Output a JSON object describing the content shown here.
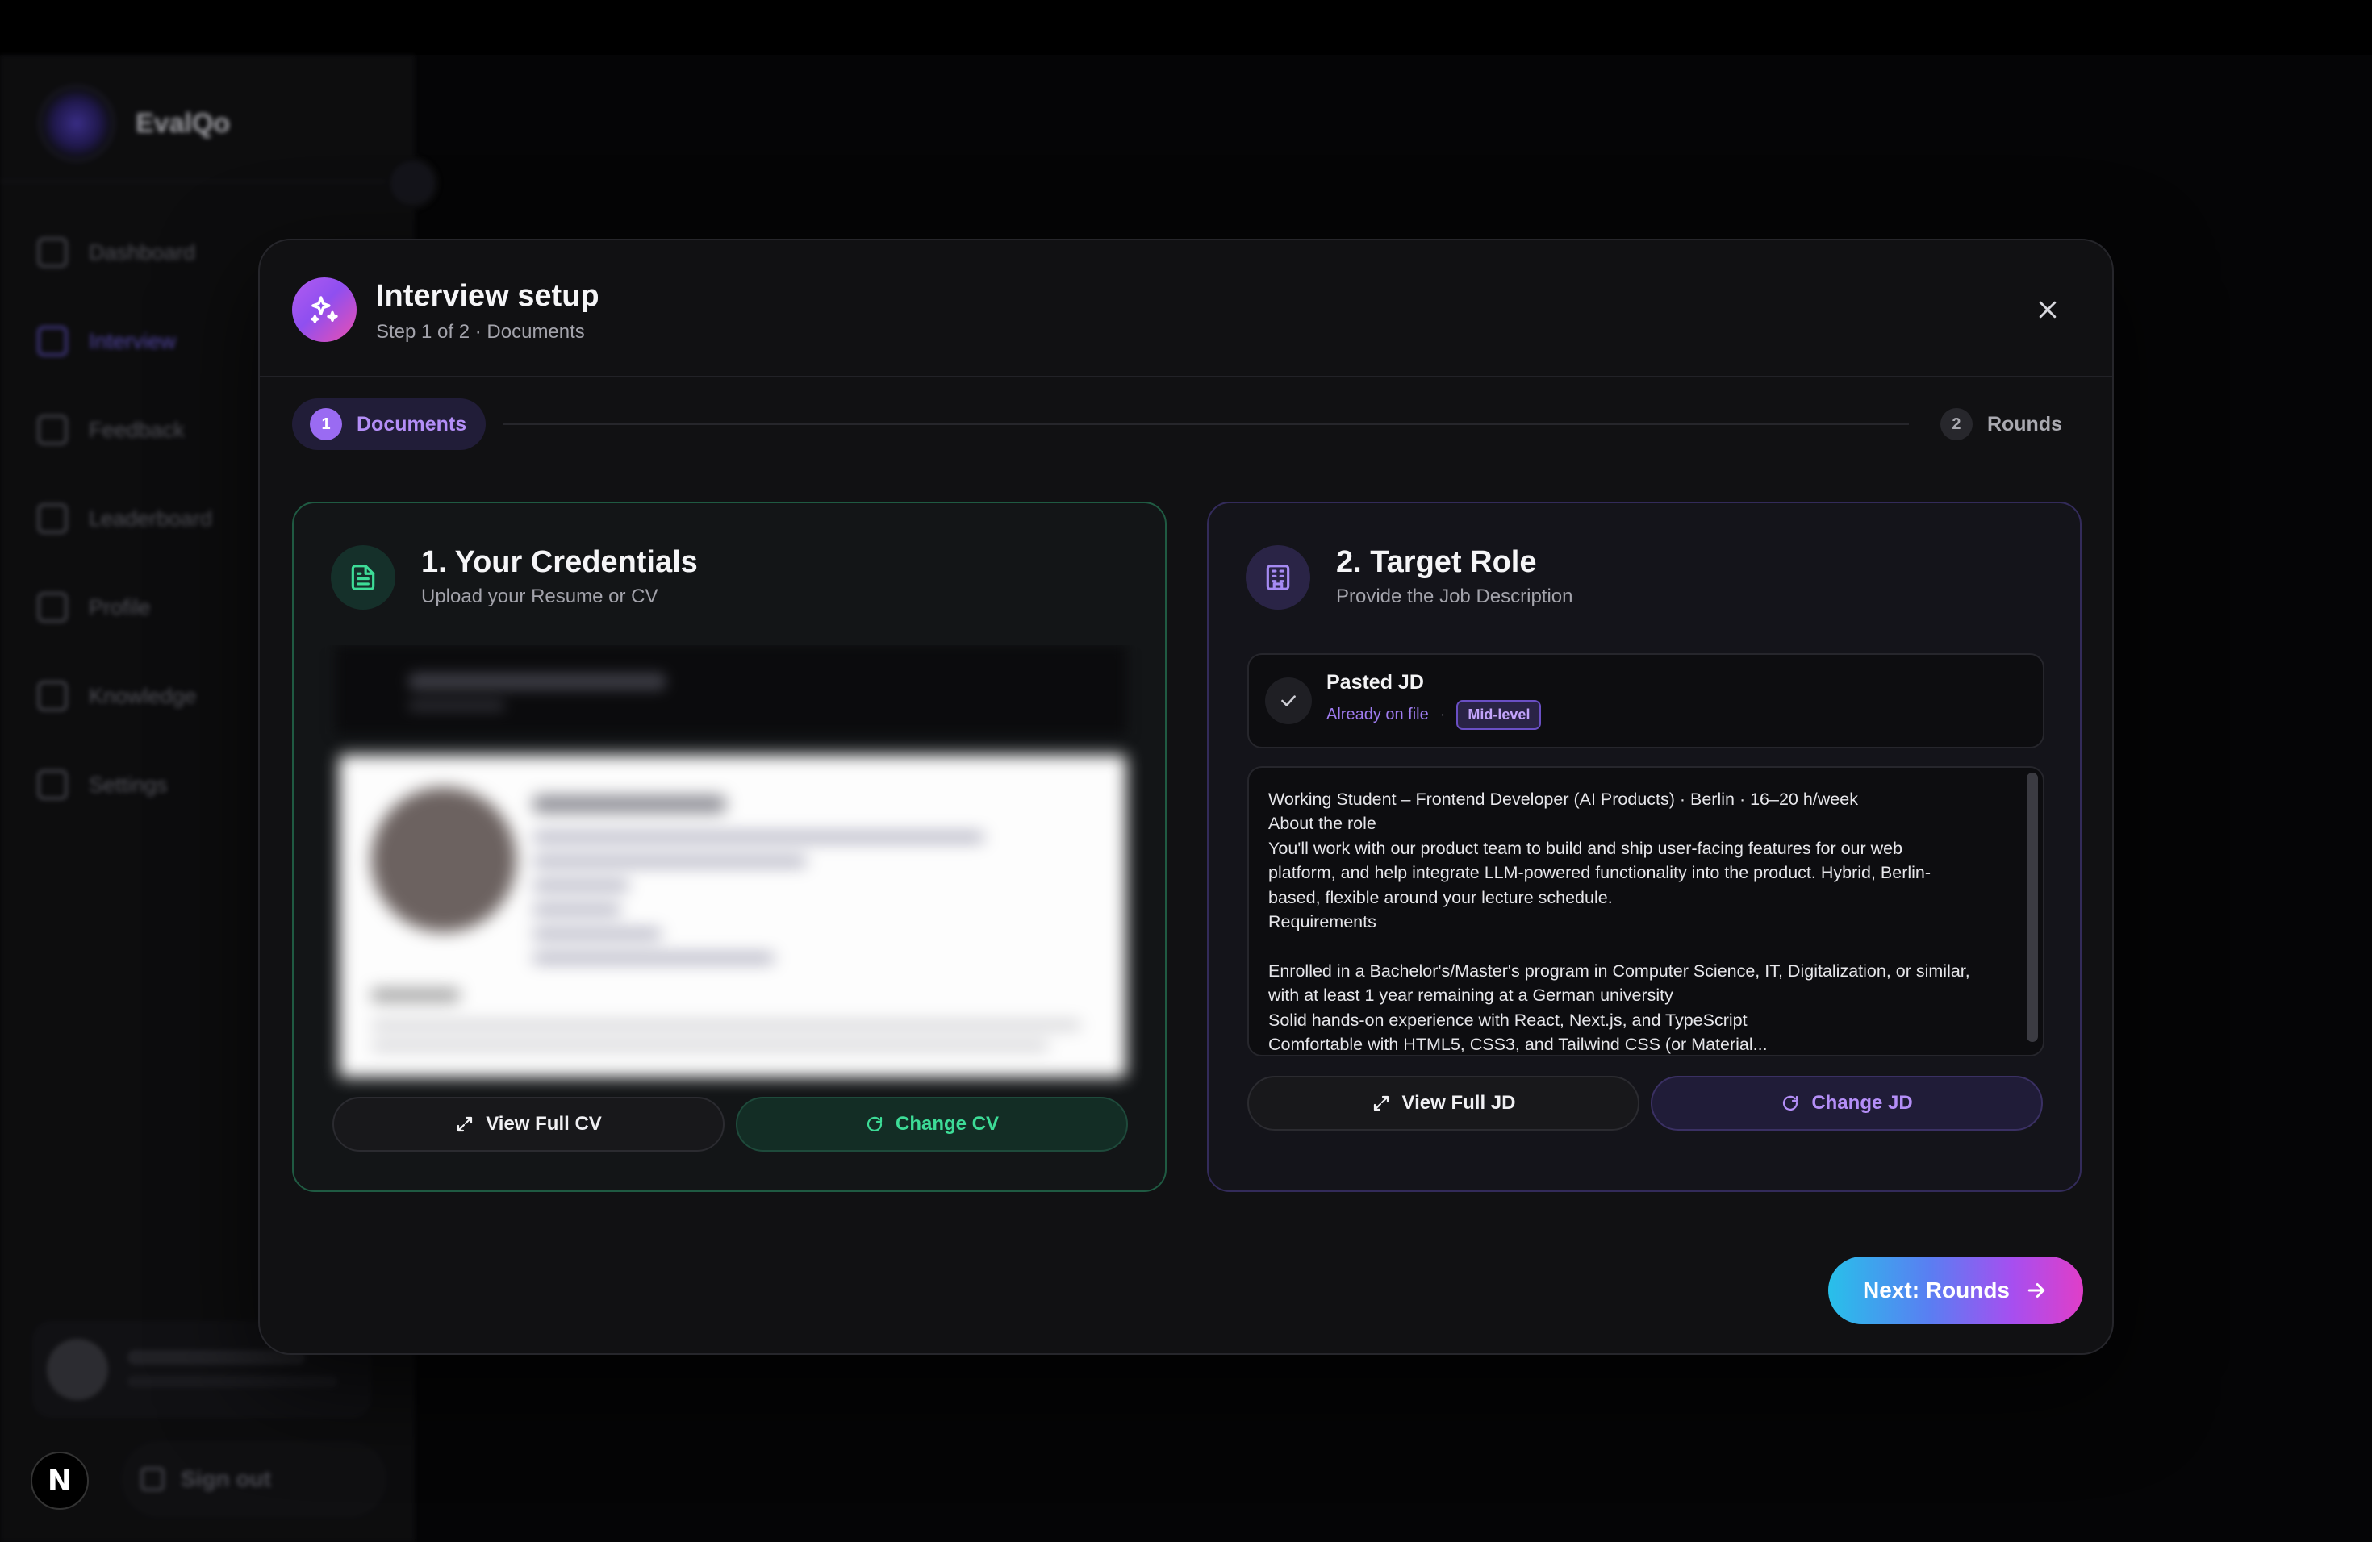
{
  "app": {
    "brand_name": "EvalQo",
    "nav": [
      {
        "label": "Dashboard",
        "icon": "grid-icon"
      },
      {
        "label": "Interview",
        "icon": "mic-icon",
        "active": true
      },
      {
        "label": "Feedback",
        "icon": "message-icon"
      },
      {
        "label": "Leaderboard",
        "icon": "trophy-icon"
      },
      {
        "label": "Profile",
        "icon": "user-icon"
      },
      {
        "label": "Knowledge",
        "icon": "book-icon"
      },
      {
        "label": "Settings",
        "icon": "gear-icon"
      }
    ],
    "sign_out": "Sign out",
    "framework_badge": "N"
  },
  "modal": {
    "title": "Interview setup",
    "subtitle": "Step 1 of 2 · Documents",
    "steps": [
      {
        "number": "1",
        "label": "Documents",
        "active": true
      },
      {
        "number": "2",
        "label": "Rounds",
        "active": false
      }
    ],
    "credentials": {
      "title": "1. Your Credentials",
      "subtitle": "Upload your Resume or CV",
      "view_button": "View Full CV",
      "change_button": "Change CV"
    },
    "target_role": {
      "title": "2. Target Role",
      "subtitle": "Provide the Job Description",
      "file_title": "Pasted JD",
      "file_status": "Already on file",
      "separator": "·",
      "level_badge": "Mid-level",
      "jd_lines": [
        "Working Student – Frontend Developer (AI Products) · Berlin · 16–20 h/week",
        "About the role",
        "You'll work with our product team to build and ship user-facing features for our web",
        "platform, and help integrate LLM-powered functionality into the product. Hybrid, Berlin-",
        "based, flexible around your lecture schedule.",
        "Requirements",
        "",
        "Enrolled in a Bachelor's/Master's program in Computer Science, IT, Digitalization, or similar,",
        "with at least 1 year remaining at a German university",
        "Solid hands-on experience with React, Next.js, and TypeScript",
        "Comfortable with HTML5, CSS3, and Tailwind CSS (or Material..."
      ],
      "view_button": "View Full JD",
      "change_button": "Change JD"
    },
    "next_button": "Next: Rounds"
  },
  "colors": {
    "accent_purple": "#9a6bf2",
    "accent_green": "#3ddc97",
    "background": "#050506",
    "modal_bg": "#111113"
  }
}
